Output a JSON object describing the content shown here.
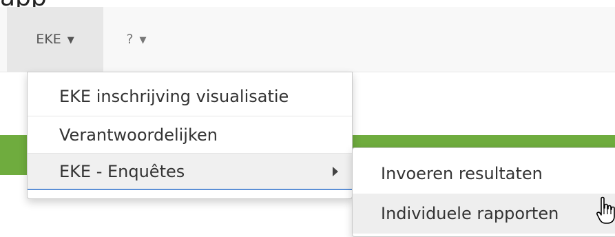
{
  "window": {
    "title_fragment": "app"
  },
  "navbar": {
    "items": [
      {
        "label": "EKE",
        "icon": "caret-down-icon"
      },
      {
        "label": "?",
        "icon": "caret-down-icon"
      }
    ]
  },
  "dropdown": {
    "items": [
      {
        "label": "EKE inschrijving visualisatie"
      },
      {
        "label": "Verantwoordelijken"
      },
      {
        "label": "EKE - Enquêtes",
        "icon": "chevron-right-icon"
      }
    ]
  },
  "submenu": {
    "items": [
      {
        "label": "Invoeren resultaten"
      },
      {
        "label": "Individuele rapporten"
      }
    ]
  },
  "colors": {
    "navbar_bg": "#f8f8f8",
    "active_nav_bg": "#e7e7e7",
    "green_bar": "#6fac3e",
    "focus_underline": "#5b8fd6"
  },
  "cursor": {
    "icon": "hand-pointer-icon"
  }
}
